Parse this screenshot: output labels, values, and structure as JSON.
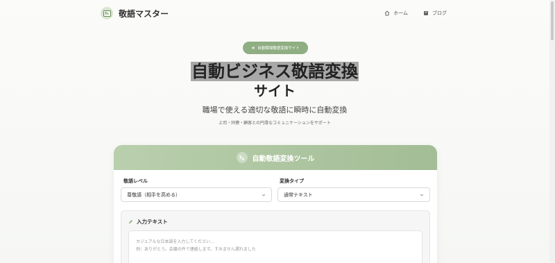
{
  "header": {
    "logo_text": "敬語マスター",
    "nav": [
      {
        "label": "ホーム",
        "icon": "home-icon"
      },
      {
        "label": "ブログ",
        "icon": "book-icon"
      }
    ]
  },
  "hero": {
    "pill": "自動職場敬語変換サイト",
    "title_line1": "自動ビジネス敬語変換",
    "title_line2": "サイト",
    "subtitle": "職場で使える適切な敬語に瞬時に自動変換",
    "note": "上司・同僚・顧客との円滑なコミュニケーションをサポート"
  },
  "tool": {
    "title": "自動敬語変換ツール",
    "level_label": "敬語レベル",
    "level_value": "尊敬語（相手を高める）",
    "type_label": "変換タイプ",
    "type_value": "通常テキスト",
    "input_title": "入力テキスト",
    "placeholder_line1": "カジュアルな日本語を入力してください...",
    "placeholder_line2": "例：ありがとう。会議の件で連絡します。すみません遅れました"
  },
  "colors": {
    "accent": "#8fae82",
    "card_header": "#a3bd96"
  }
}
